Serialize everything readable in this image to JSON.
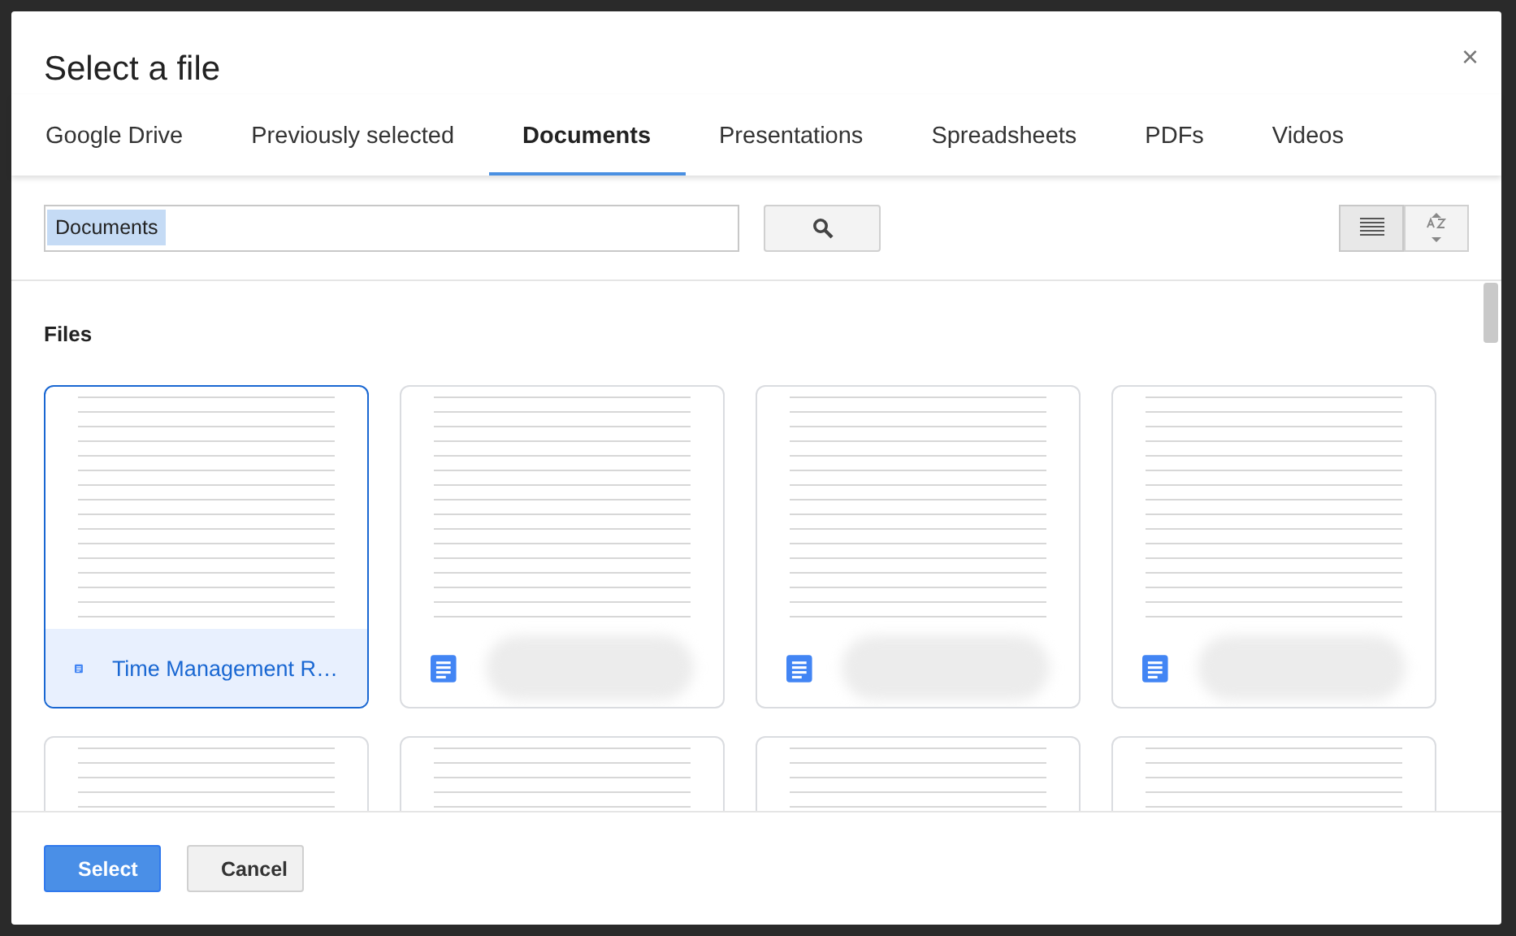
{
  "window": {
    "title": "Select a file",
    "close": "×"
  },
  "tabs": [
    {
      "label": "Google Drive",
      "selected": false
    },
    {
      "label": "Previously selected",
      "selected": false
    },
    {
      "label": "Documents",
      "selected": true
    },
    {
      "label": "Presentations",
      "selected": false
    },
    {
      "label": "Spreadsheets",
      "selected": false
    },
    {
      "label": "PDFs",
      "selected": false
    },
    {
      "label": "Videos",
      "selected": false
    }
  ],
  "search": {
    "value": "Documents",
    "text_selected": true
  },
  "section_title": "Files",
  "files": [
    {
      "kind": "named",
      "name": "Time Management R…",
      "selected": true
    },
    {
      "kind": "blurred",
      "selected": false
    },
    {
      "kind": "blurred",
      "selected": false
    },
    {
      "kind": "blurred",
      "selected": false
    },
    {
      "kind": "hidden",
      "selected": false
    },
    {
      "kind": "hidden",
      "selected": false
    },
    {
      "kind": "hidden",
      "selected": false
    },
    {
      "kind": "hidden",
      "selected": false
    }
  ],
  "buttons": [
    {
      "label": "Select",
      "kind": "primary"
    },
    {
      "label": "Cancel",
      "kind": "secondary"
    }
  ]
}
